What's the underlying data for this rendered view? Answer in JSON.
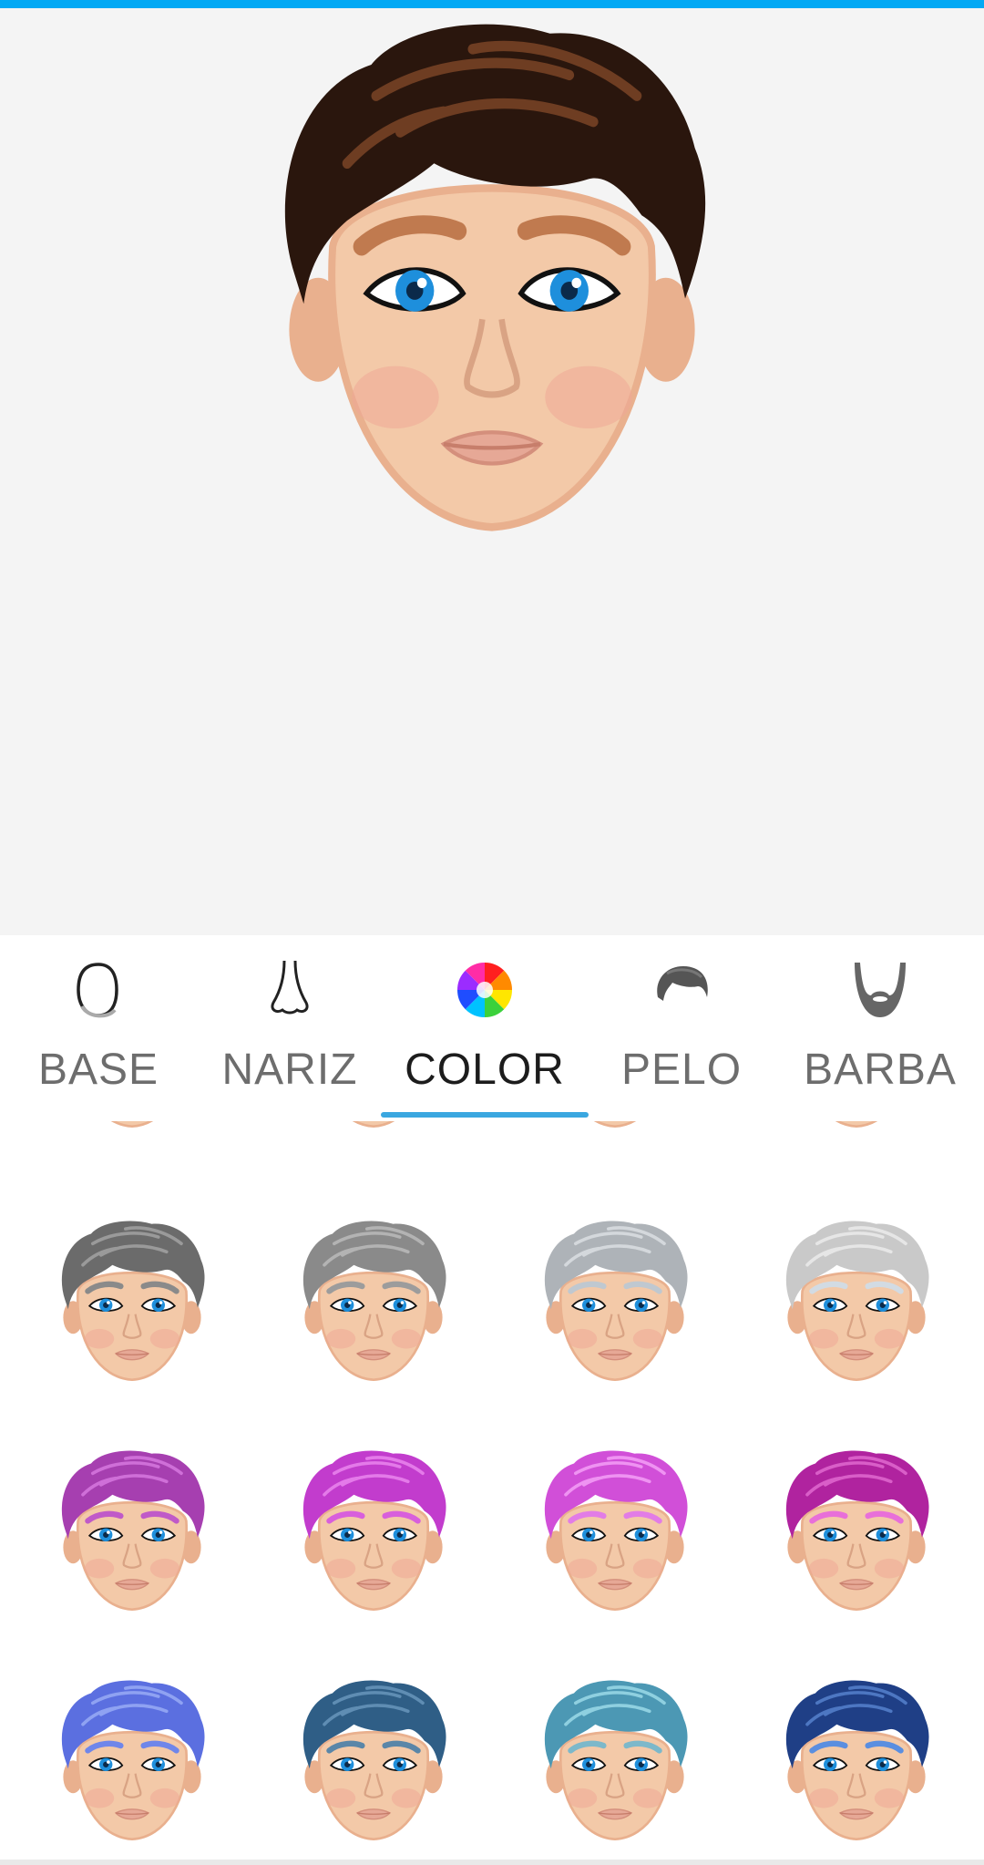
{
  "theme": {
    "accent": "#03a9f4",
    "indicator": "#3aa7e0",
    "preview_bg": "#f4f4f4",
    "skin": "#f3c9a8",
    "skin_shade": "#e9b08e",
    "eye_iris": "#1e8fdc",
    "lips": "#e6a896"
  },
  "preview": {
    "hair_color": "#2a160d",
    "hair_highlight": "#6e3d22",
    "brow_color": "#c07a4f"
  },
  "tabs": [
    {
      "id": "base",
      "label": "BASE",
      "icon": "face-outline-icon"
    },
    {
      "id": "nariz",
      "label": "NARIZ",
      "icon": "nose-icon"
    },
    {
      "id": "color",
      "label": "COLOR",
      "icon": "color-wheel-icon",
      "active": true
    },
    {
      "id": "pelo",
      "label": "PELO",
      "icon": "hair-icon"
    },
    {
      "id": "barba",
      "label": "BARBA",
      "icon": "beard-icon"
    }
  ],
  "color_options": [
    {
      "hair": "#6b6b6b",
      "highlight": "#9a9a9a",
      "brow": "#8a8a8a"
    },
    {
      "hair": "#8a8a8a",
      "highlight": "#b3b3b3",
      "brow": "#9c9c9c"
    },
    {
      "hair": "#aeb3b8",
      "highlight": "#d4d8dc",
      "brow": "#bfc8d0"
    },
    {
      "hair": "#c9c9c9",
      "highlight": "#e6e6e6",
      "brow": "#d2dbe3"
    },
    {
      "hair": "#a63fb0",
      "highlight": "#cf6fd8",
      "brow": "#c05ac8"
    },
    {
      "hair": "#c23ccd",
      "highlight": "#e47ae9",
      "brow": "#d85fdc"
    },
    {
      "hair": "#d14fd8",
      "highlight": "#ef93f2",
      "brow": "#e27ce6"
    },
    {
      "hair": "#b0239f",
      "highlight": "#d95ec8",
      "brow": "#e86fd9"
    },
    {
      "hair": "#5b6fe0",
      "highlight": "#8fa2f2",
      "brow": "#6f86ea"
    },
    {
      "hair": "#2f5e86",
      "highlight": "#5f8db3",
      "brow": "#5a86a8"
    },
    {
      "hair": "#4c98b4",
      "highlight": "#8fd0e0",
      "brow": "#7cb8ca"
    },
    {
      "hair": "#1f3f86",
      "highlight": "#4d77c2",
      "brow": "#5a8ee0"
    }
  ]
}
